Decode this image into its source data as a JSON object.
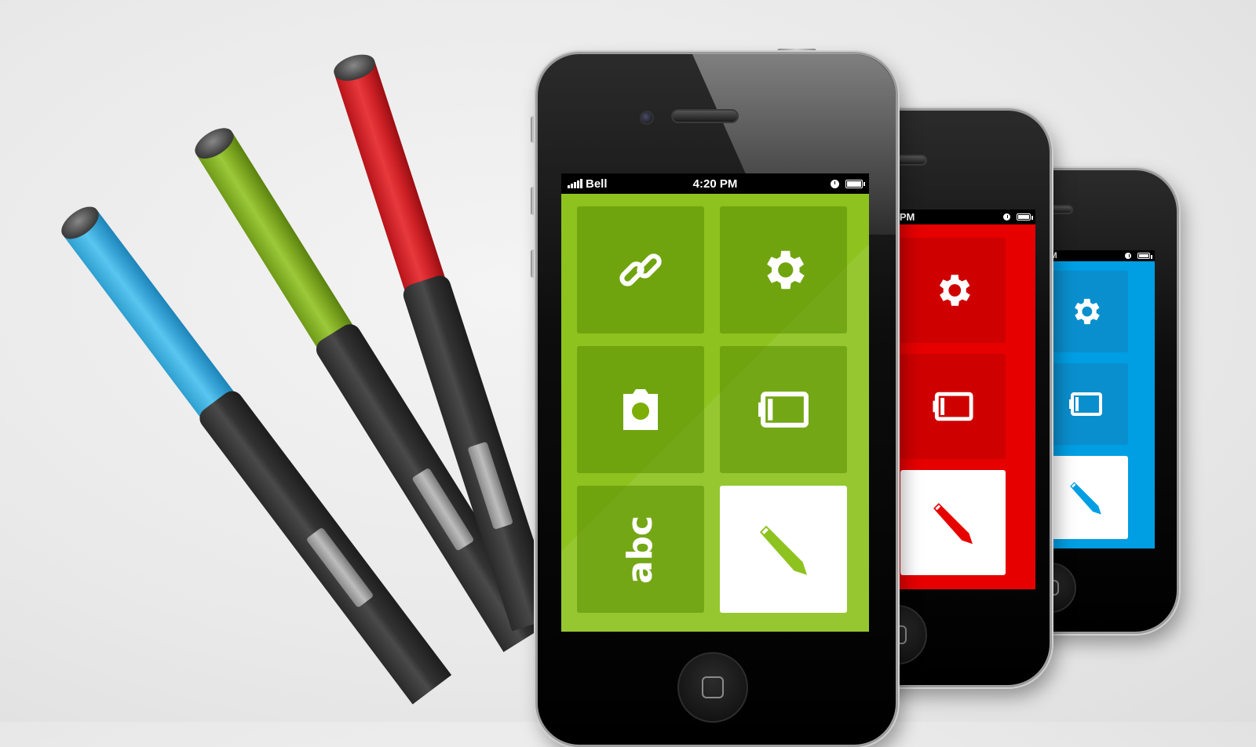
{
  "colors": {
    "green": "#8dc21f",
    "green_tile": "#7cae05",
    "red": "#e60000",
    "red_tile": "#cf0000",
    "blue": "#009ee3",
    "blue_tile": "#0a8fce",
    "white_tile": "#ffffff"
  },
  "status_bar": {
    "carrier": "Bell",
    "time": "4:20 PM",
    "time_partial": "0 PM"
  },
  "main_phone": {
    "theme": "green",
    "tiles": [
      {
        "name": "link",
        "icon": "link-icon"
      },
      {
        "name": "settings",
        "icon": "gear-icon"
      },
      {
        "name": "camera",
        "icon": "camera-icon"
      },
      {
        "name": "battery",
        "icon": "battery-icon"
      },
      {
        "name": "text",
        "icon": "text-icon",
        "label": "abc"
      },
      {
        "name": "pencil",
        "icon": "pencil-icon",
        "selected": true
      }
    ]
  },
  "middle_phone": {
    "theme": "red",
    "tiles": [
      {
        "name": "settings",
        "icon": "gear-icon"
      },
      {
        "name": "battery",
        "icon": "battery-icon"
      },
      {
        "name": "pencil",
        "icon": "pencil-icon",
        "selected": true
      }
    ]
  },
  "back_phone": {
    "theme": "blue",
    "tiles": [
      {
        "name": "settings",
        "icon": "gear-icon"
      },
      {
        "name": "battery",
        "icon": "battery-icon"
      },
      {
        "name": "pencil",
        "icon": "pencil-icon",
        "selected": true
      }
    ]
  },
  "pens": [
    {
      "color": "blue",
      "hex": "#4fc3ef"
    },
    {
      "color": "green",
      "hex": "#8fbf2c"
    },
    {
      "color": "red",
      "hex": "#e0262b"
    }
  ]
}
